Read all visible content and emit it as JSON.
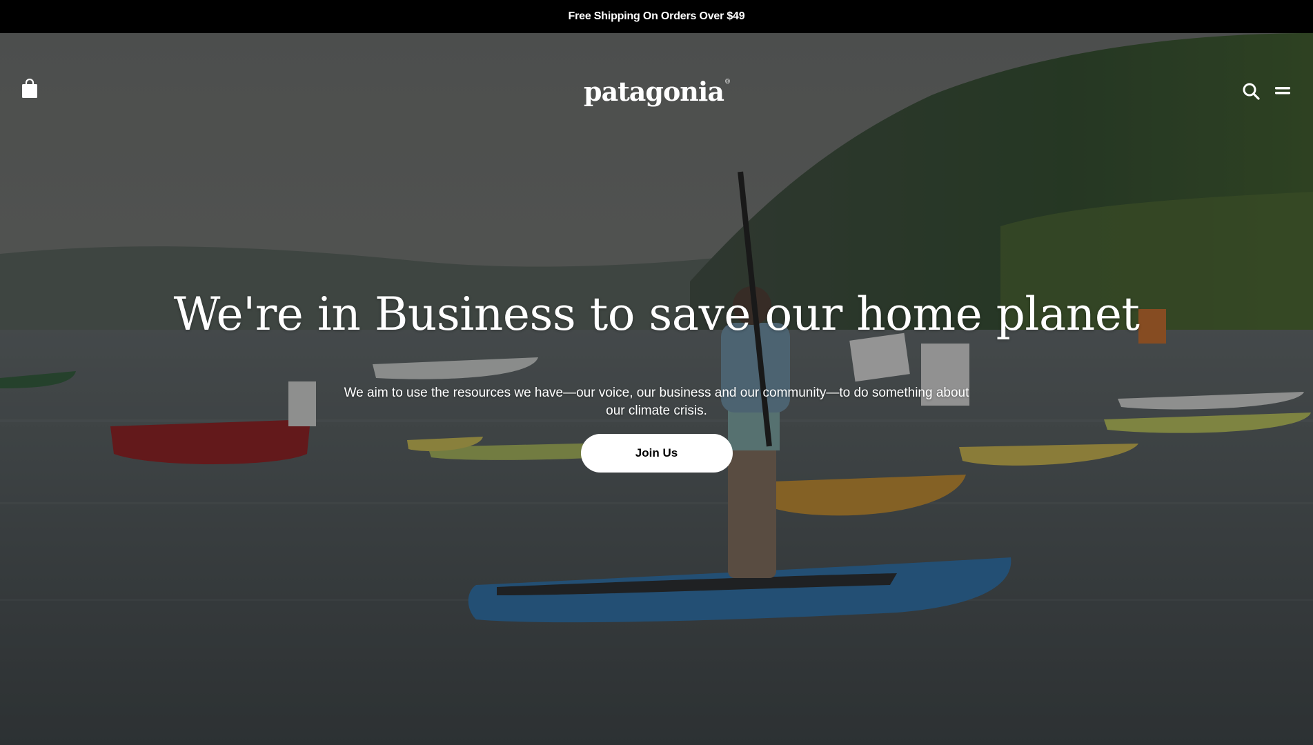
{
  "announcement": {
    "text": "Free Shipping On Orders Over $49"
  },
  "header": {
    "logo_text": "patagonia",
    "logo_mark": "®",
    "icons": {
      "bag": "shopping-bag-icon",
      "search": "search-icon",
      "menu": "hamburger-menu-icon"
    }
  },
  "hero": {
    "title": "We're in Business to save our home planet",
    "subtitle": "We aim to use the resources we have—our voice, our business and our community—to do something about our climate crisis.",
    "cta_label": "Join Us",
    "colors": {
      "overlay": "#141414",
      "button_bg": "#ffffff",
      "button_text": "#000000"
    }
  }
}
